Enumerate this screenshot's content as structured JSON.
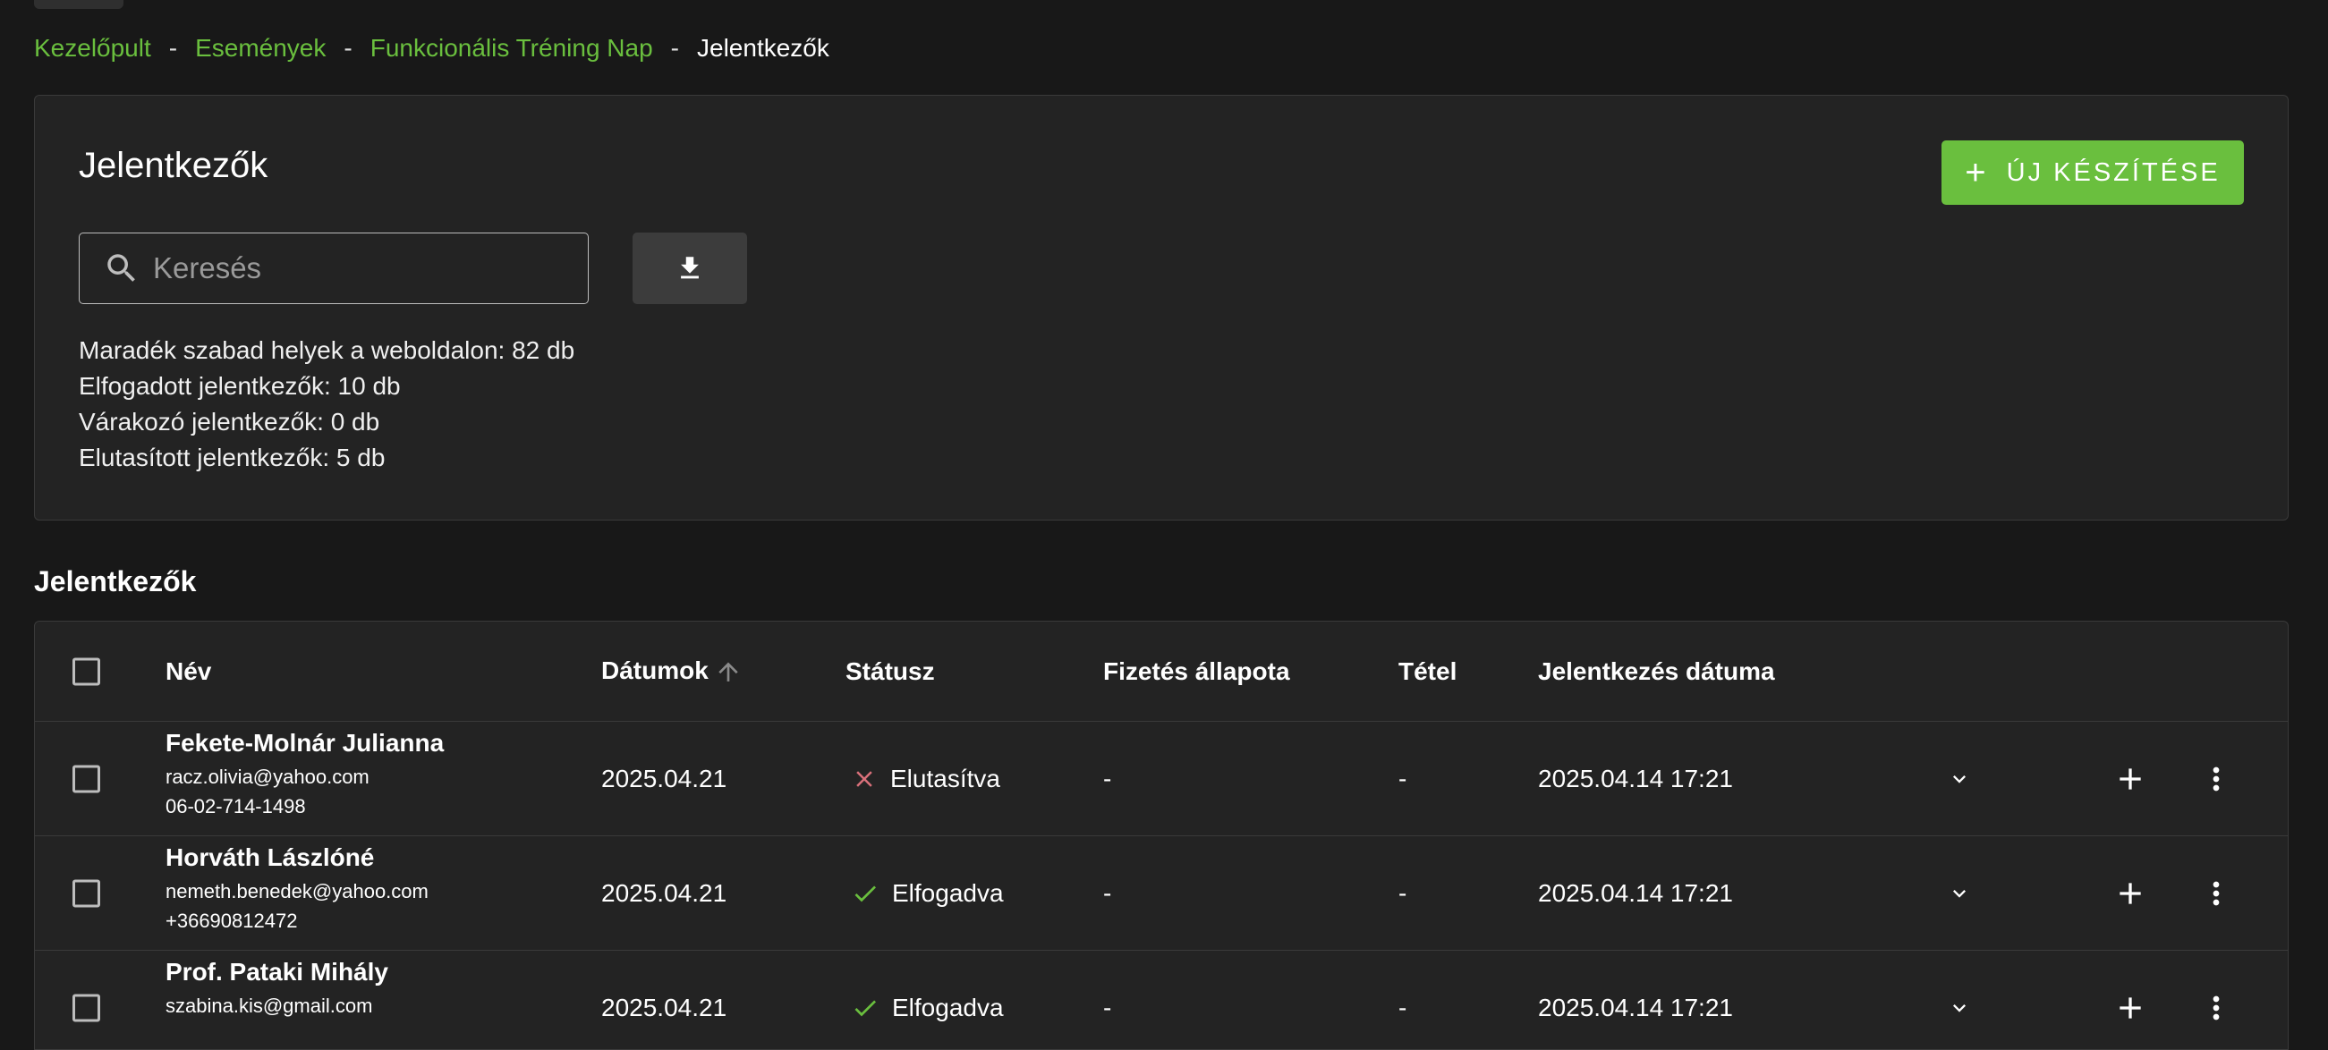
{
  "breadcrumb": {
    "items": [
      "Kezelőpult",
      "Események",
      "Funkcionális Tréning Nap"
    ],
    "current": "Jelentkezők",
    "separator": "-"
  },
  "panel": {
    "title": "Jelentkezők",
    "new_button_label": "ÚJ KÉSZÍTÉSE",
    "search_placeholder": "Keresés",
    "stats": [
      "Maradék szabad helyek a weboldalon: 82 db",
      "Elfogadott jelentkezők: 10 db",
      "Várakozó jelentkezők: 0 db",
      "Elutasított jelentkezők: 5 db"
    ]
  },
  "section_title": "Jelentkezők",
  "table": {
    "headers": {
      "name": "Név",
      "dates": "Dátumok",
      "status": "Státusz",
      "payment": "Fizetés állapota",
      "item": "Tétel",
      "applied": "Jelentkezés dátuma"
    },
    "rows": [
      {
        "name": "Fekete-Molnár Julianna",
        "email": "racz.olivia@yahoo.com",
        "phone": "06-02-714-1498",
        "date": "2025.04.21",
        "status": "Elutasítva",
        "status_kind": "rejected",
        "payment": "-",
        "item": "-",
        "applied": "2025.04.14 17:21"
      },
      {
        "name": "Horváth Lászlóné",
        "email": "nemeth.benedek@yahoo.com",
        "phone": "+36690812472",
        "date": "2025.04.21",
        "status": "Elfogadva",
        "status_kind": "accepted",
        "payment": "-",
        "item": "-",
        "applied": "2025.04.14 17:21"
      },
      {
        "name": "Prof. Pataki Mihály",
        "email": "szabina.kis@gmail.com",
        "phone": "",
        "date": "2025.04.21",
        "status": "Elfogadva",
        "status_kind": "accepted",
        "payment": "-",
        "item": "-",
        "applied": "2025.04.14 17:21"
      }
    ]
  },
  "colors": {
    "accent": "#6abf3e",
    "rejected": "#d9707a",
    "background": "#181818",
    "panel": "#232323"
  },
  "icons": [
    "search-icon",
    "download-icon",
    "plus-icon",
    "sort-arrow-up-icon",
    "close-icon",
    "check-icon",
    "chevron-down-icon",
    "more-vert-icon"
  ]
}
